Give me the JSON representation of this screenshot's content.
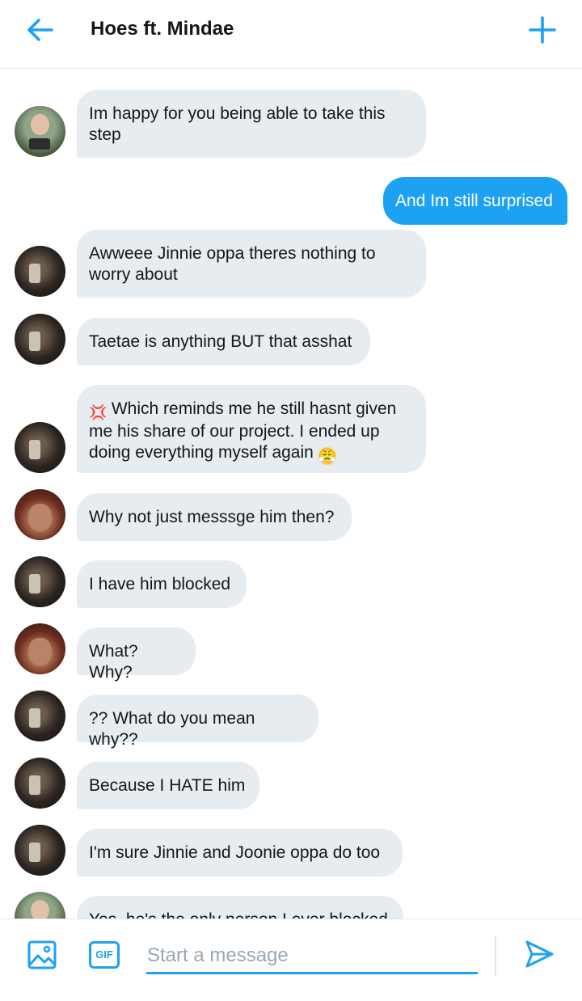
{
  "header": {
    "title": "Hoes ft. Mindae"
  },
  "icons": {
    "back": "arrow-left-icon",
    "add": "plus-icon",
    "media": "image-icon",
    "gif": "gif-icon",
    "send": "send-icon"
  },
  "colors": {
    "accent": "#1da1f2",
    "bubble_in": "#e6ecf0"
  },
  "messages": [
    {
      "sender": "jinnie",
      "direction": "in",
      "text": "Im happy for you being able to take this step"
    },
    {
      "sender": "me",
      "direction": "out",
      "text": "And Im still surprised"
    },
    {
      "sender": "mindae",
      "direction": "in",
      "text": "Awweee Jinnie oppa theres nothing to worry about"
    },
    {
      "sender": "mindae",
      "direction": "in",
      "text": "Taetae is anything BUT that asshat"
    },
    {
      "sender": "mindae",
      "direction": "in",
      "emoji_lead": "💢",
      "text": "Which reminds me he still hasnt given me his share of our project. I ended up doing everything myself again",
      "emoji_trail": "😤"
    },
    {
      "sender": "taetae",
      "direction": "in",
      "text": "Why not just messsge him then?"
    },
    {
      "sender": "mindae",
      "direction": "in",
      "text": "I have him blocked"
    },
    {
      "sender": "taetae",
      "direction": "in",
      "text": "What? Why?"
    },
    {
      "sender": "mindae",
      "direction": "in",
      "text": "?? What do you mean why??"
    },
    {
      "sender": "mindae",
      "direction": "in",
      "text": "Because I HATE him"
    },
    {
      "sender": "mindae",
      "direction": "in",
      "text": "I'm sure Jinnie and Joonie oppa do too"
    },
    {
      "sender": "jinnie",
      "direction": "in",
      "text": "Yes, he's the only person I ever blocked"
    }
  ],
  "composer": {
    "placeholder": "Start a message",
    "gif_label": "GIF"
  }
}
